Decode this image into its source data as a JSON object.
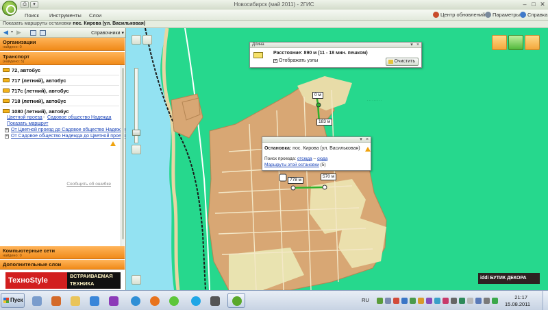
{
  "window": {
    "title": "Новосибирск (май 2011) - 2ГИС"
  },
  "menu": {
    "items": [
      "Поиск",
      "Инструменты",
      "Слои"
    ],
    "right": {
      "updates": "Центр обновлений",
      "params": "Параметры",
      "help": "Справка"
    }
  },
  "crumb": {
    "prefix": "Показать маршруты остановки",
    "stop": "пос. Кирова (ул. Васильковая)"
  },
  "panel": {
    "directory": "Справочники",
    "org": {
      "title": "Организации",
      "sub": "найдено: 0"
    },
    "transport": {
      "title": "Транспорт",
      "sub": "(найдено: 5)"
    },
    "routes": [
      "72, автобус",
      "717 (летний), автобус",
      "717с (летний), автобус",
      "718 (летний), автобус",
      "1080 (летний), автобус"
    ],
    "detail": {
      "from": "Цветной проезд",
      "dash": "-",
      "to": "Садовое общество Надежда",
      "show": "Показать маршрут",
      "dir1": "От Цветной проезд до Садовое общество Надежда",
      "dir2": "От Садовое общество Надежда до Цветной проезд"
    },
    "report": "Сообщить об ошибке",
    "networks": {
      "title": "Компьютерные сети",
      "sub": "найдено: 0"
    },
    "layers": {
      "title": "Дополнительные слои"
    }
  },
  "ad": {
    "brand": "ТехноStyle",
    "line1": "ВСТРАИВАЕМАЯ",
    "line2": "ТЕХНИКА"
  },
  "measure": {
    "header": "Длина",
    "distance": "Расстояние: 890 м (11 - 18 мин. пешком)",
    "show_nodes": "Отображать узлы",
    "clear": "Очистить"
  },
  "stop_popup": {
    "title_label": "Остановка:",
    "title_value": "пос. Кирова (ул. Васильковая)",
    "search_label": "Поиск проезда:",
    "from": "отсюда",
    "dash": "–",
    "to": "сюда",
    "routes_link": "Маршруты этой остановки",
    "routes_count": "(5)"
  },
  "map_labels": {
    "d0": "0 м",
    "d183": "183 м",
    "d778": "778 м",
    "d570": "570 м"
  },
  "map_ad": "iddi БУТИК ДЕКОРА",
  "taskbar": {
    "start": "Пуск",
    "lang": "RU",
    "time": "21:17",
    "date": "15.08.2011"
  },
  "colors": {
    "map_green": "#26d88d",
    "built_area": "#d8a774",
    "water": "#93e2f2",
    "route_line": "#2fb12c",
    "panel_orange": "#f08a18"
  }
}
